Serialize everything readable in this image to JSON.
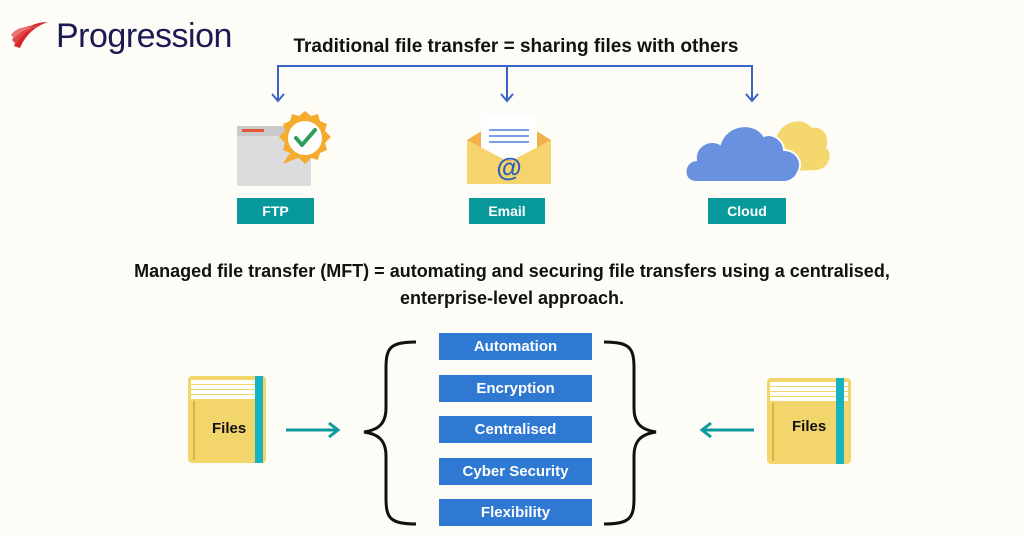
{
  "brand": {
    "name": "Progression",
    "text_color": "#1b1a55",
    "swoosh_color": "#d8262b"
  },
  "traditional": {
    "heading": "Traditional file transfer = sharing files with others",
    "connector_color": "#3a63c6",
    "methods": [
      {
        "label": "FTP",
        "icon": "ftp-window-badge-icon"
      },
      {
        "label": "Email",
        "icon": "envelope-at-icon"
      },
      {
        "label": "Cloud",
        "icon": "cloud-icon"
      }
    ],
    "label_color": "#089a9a"
  },
  "mft": {
    "heading_line1": "Managed file transfer (MFT) = automating and securing file transfers using a centralised,",
    "heading_line2": "enterprise-level approach.",
    "features": [
      "Automation",
      "Encryption",
      "Centralised",
      "Cyber Security",
      "Flexibility"
    ],
    "feature_color": "#2f79d2",
    "left_files_label": "Files",
    "right_files_label": "Files",
    "arrow_color": "#0f9aa0"
  }
}
